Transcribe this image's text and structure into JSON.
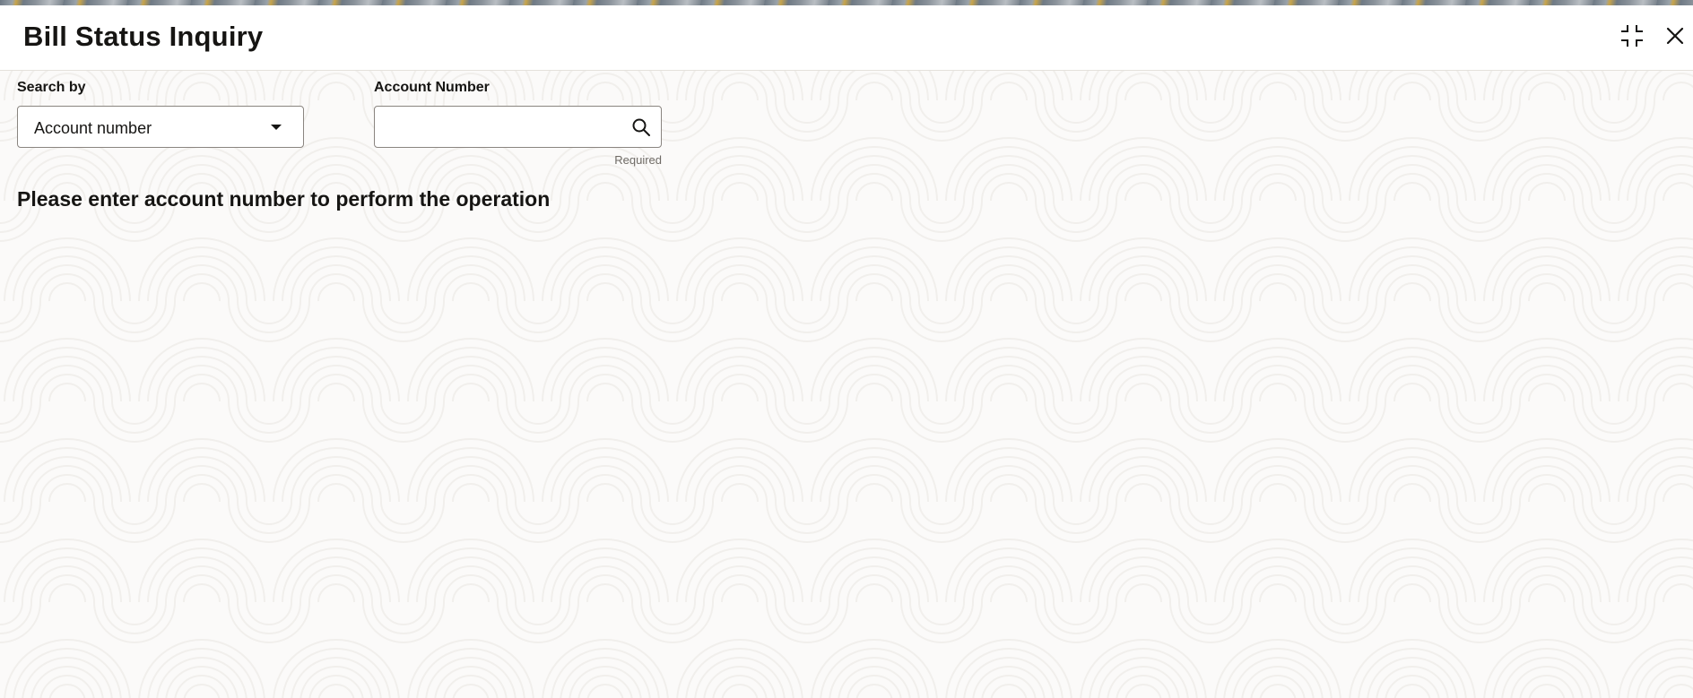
{
  "header": {
    "title": "Bill Status Inquiry",
    "minimize_icon": "compress-icon",
    "close_icon": "close-icon"
  },
  "form": {
    "search_by": {
      "label": "Search by",
      "selected_value": "Account number",
      "icon": "chevron-down-icon"
    },
    "account_number": {
      "label": "Account Number",
      "value": "",
      "placeholder": "",
      "required_note": "Required",
      "icon": "search-icon"
    }
  },
  "message": "Please enter account number to perform the operation",
  "colors": {
    "text": "#161513",
    "border": "#8a8580",
    "background": "#fbfaf9",
    "muted_text": "#6f6b66"
  }
}
